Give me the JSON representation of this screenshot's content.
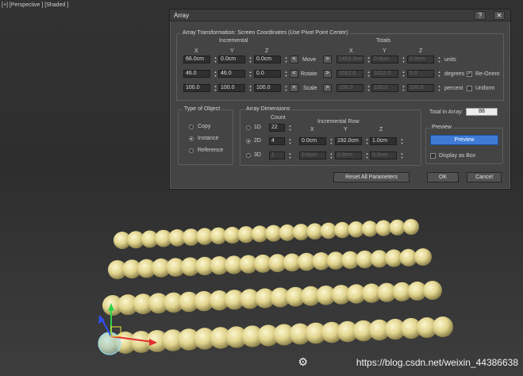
{
  "viewport": {
    "label": "[+] [Perspective ] [Shaded ]",
    "watermark": "https://blog.csdn.net/weixin_44386638",
    "watermark_logo": "⚙"
  },
  "dialog": {
    "title": "Array",
    "help_label": "?",
    "close_label": "✕",
    "transformation": {
      "title": "Array Transformation: Screen Coordinates (Use Pivot Point Center)",
      "incremental_label": "Incremental",
      "totals_label": "Totals",
      "axis_x": "X",
      "axis_y": "Y",
      "axis_z": "Z",
      "left_arrow": "<",
      "right_arrow": ">",
      "rows": [
        {
          "name": "Move",
          "inc": [
            "66.0cm",
            "0.0cm",
            "0.0cm"
          ],
          "tot": [
            "1452.0cm",
            "0.0cm",
            "0.0cm"
          ],
          "unit": "units"
        },
        {
          "name": "Rotate",
          "inc": [
            "46.0",
            "46.0",
            "0.0"
          ],
          "tot": [
            "1012.0",
            "1012.0",
            "0.0"
          ],
          "unit": "degrees"
        },
        {
          "name": "Scale",
          "inc": [
            "100.0",
            "100.0",
            "100.0"
          ],
          "tot": [
            "100.0",
            "100.0",
            "100.0"
          ],
          "unit": "percent"
        }
      ],
      "reorient_label": "Re-Orient",
      "reorient_checked": true,
      "uniform_label": "Uniform",
      "uniform_checked": false
    },
    "type_of_object": {
      "title": "Type of Object",
      "options": [
        "Copy",
        "Instance",
        "Reference"
      ],
      "selected": "Instance"
    },
    "array_dimensions": {
      "title": "Array Dimensions",
      "count_label": "Count",
      "incremental_row_label": "Incremental Row",
      "axis_x": "X",
      "axis_y": "Y",
      "axis_z": "Z",
      "rows": [
        {
          "label": "1D",
          "count": "22",
          "x": "",
          "y": "",
          "z": ""
        },
        {
          "label": "2D",
          "count": "4",
          "x": "0.0cm",
          "y": "192.0cm",
          "z": "1.0cm"
        },
        {
          "label": "3D",
          "count": "1",
          "x": "0.0cm",
          "y": "0.0cm",
          "z": "0.0cm"
        }
      ],
      "selected": "2D"
    },
    "total_in_array": {
      "label": "Total in Array:",
      "value": "88"
    },
    "preview": {
      "title": "Preview",
      "button_label": "Preview",
      "display_as_box_label": "Display as Box",
      "display_as_box_checked": false
    },
    "buttons": {
      "reset": "Reset All Parameters",
      "ok": "OK",
      "cancel": "Cancel"
    }
  }
}
